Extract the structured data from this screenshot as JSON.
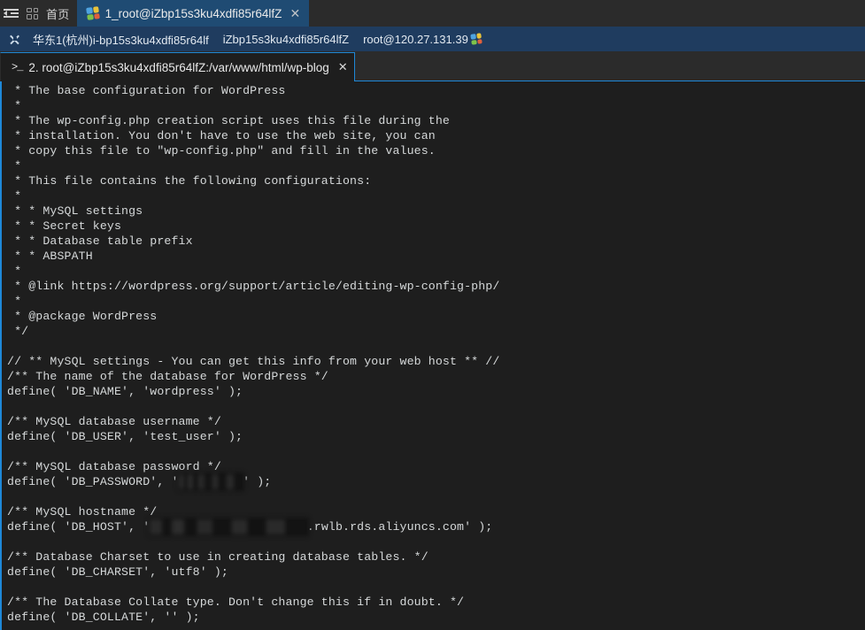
{
  "topbar": {
    "collapse_icon": "sidebar-collapse-icon",
    "grid_icon": "grid-icon",
    "home_label": "首页",
    "window_tab": {
      "icon": "puzzle-icon",
      "title": "1_root@iZbp15s3ku4xdfi85r64lfZ",
      "close": "✕"
    }
  },
  "hostbar": {
    "expand_icon": "expand-collapse-icon",
    "segments": [
      "华东1(杭州)i-bp15s3ku4xdfi85r64lf",
      "iZbp15s3ku4xdfi85r64lfZ",
      "root@120.27.131.39"
    ]
  },
  "sessionbar": {
    "tab": {
      "prompt_icon": ">_",
      "title": "2. root@iZbp15s3ku4xdfi85r64lfZ:/var/www/html/wp-blog",
      "close": "✕"
    }
  },
  "colors": {
    "accent_blue": "#1e88d8",
    "hostbar_bg": "#1f3c5f",
    "topbar_bg": "#2b2b2b",
    "terminal_bg": "#1e1e1e",
    "terminal_fg": "#d6d9da"
  },
  "terminal": {
    "lines": [
      " * The base configuration for WordPress",
      " *",
      " * The wp-config.php creation script uses this file during the",
      " * installation. You don't have to use the web site, you can",
      " * copy this file to \"wp-config.php\" and fill in the values.",
      " *",
      " * This file contains the following configurations:",
      " *",
      " * * MySQL settings",
      " * * Secret keys",
      " * * Database table prefix",
      " * * ABSPATH",
      " *",
      " * @link https://wordpress.org/support/article/editing-wp-config-php/",
      " *",
      " * @package WordPress",
      " */",
      "",
      "// ** MySQL settings - You can get this info from your web host ** //",
      "/** The name of the database for WordPress */",
      "define( 'DB_NAME', 'wordpress' );",
      "",
      "/** MySQL database username */",
      "define( 'DB_USER', 'test_user' );",
      "",
      "/** MySQL database password */",
      {
        "pre": "define( 'DB_PASSWORD', '",
        "redacted": "XXXXXXXXX",
        "post": "' );"
      },
      "",
      "/** MySQL hostname */",
      {
        "pre": "define( 'DB_HOST', '",
        "redacted": "XXXXXXXXXXXXXXXXXXXXXX",
        "post": ".rwlb.rds.aliyuncs.com' );"
      },
      "",
      "/** Database Charset to use in creating database tables. */",
      "define( 'DB_CHARSET', 'utf8' );",
      "",
      "/** The Database Collate type. Don't change this if in doubt. */",
      "define( 'DB_COLLATE', '' );"
    ]
  }
}
